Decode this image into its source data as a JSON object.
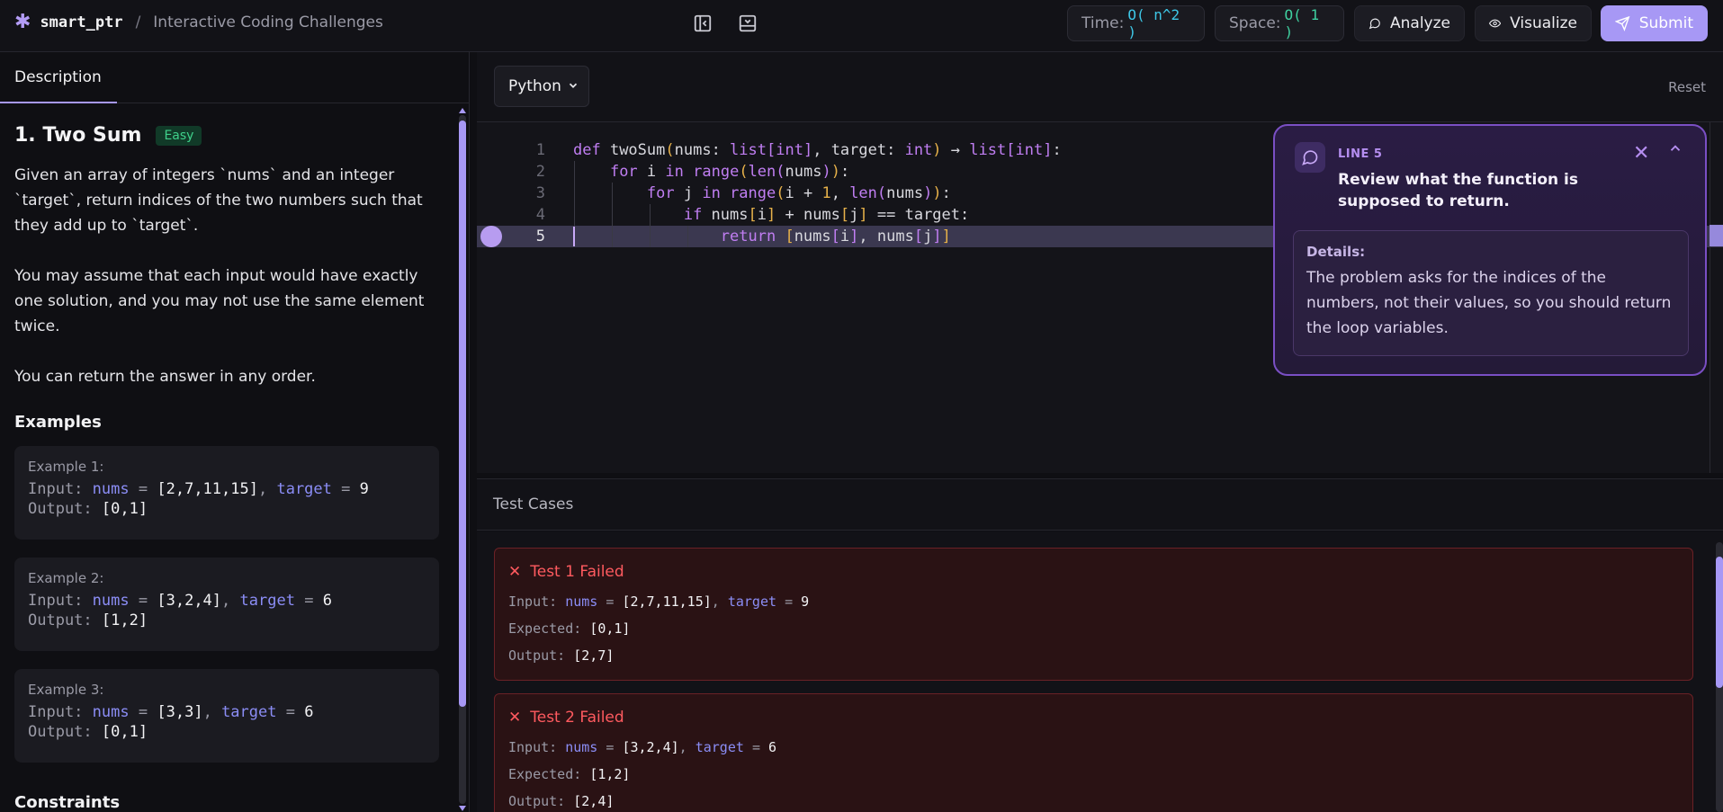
{
  "header": {
    "brand_name": "smart_ptr",
    "brand_sep": "/",
    "subtitle": "Interactive Coding Challenges",
    "time_label": "Time:",
    "time_value": "O( n^2 )",
    "space_label": "Space:",
    "space_value": "O( 1 )",
    "analyze": "Analyze",
    "visualize": "Visualize",
    "submit": "Submit"
  },
  "left": {
    "tab": "Description",
    "title": "1. Two Sum",
    "difficulty": "Easy",
    "p1": "Given an array of integers `nums` and an integer `target`, return indices of the two numbers such that they add up to `target`.",
    "p2": "You may assume that each input would have exactly one solution, and you may not use the same element twice.",
    "p3": "You can return the answer in any order.",
    "examples_heading": "Examples",
    "constraints_heading": "Constraints",
    "examples": [
      {
        "title": "Example 1:",
        "input_label": "Input:",
        "v1": "nums",
        "eq1": "=",
        "val1": "[2,7,11,15]",
        "comma": ",",
        "v2": "target",
        "eq2": "=",
        "val2": "9",
        "output_label": "Output:",
        "output": "[0,1]"
      },
      {
        "title": "Example 2:",
        "input_label": "Input:",
        "v1": "nums",
        "eq1": "=",
        "val1": "[3,2,4]",
        "comma": ",",
        "v2": "target",
        "eq2": "=",
        "val2": "6",
        "output_label": "Output:",
        "output": "[1,2]"
      },
      {
        "title": "Example 3:",
        "input_label": "Input:",
        "v1": "nums",
        "eq1": "=",
        "val1": "[3,3]",
        "comma": ",",
        "v2": "target",
        "eq2": "=",
        "val2": "6",
        "output_label": "Output:",
        "output": "[0,1]"
      }
    ]
  },
  "editor": {
    "language": "Python",
    "reset": "Reset",
    "line_numbers": [
      "1",
      "2",
      "3",
      "4",
      "5"
    ]
  },
  "review": {
    "line": "LINE 5",
    "title": "Review what the function is supposed to return.",
    "details_heading": "Details:",
    "details_body": "The problem asks for the indices of the numbers, not their values, so you should return the loop variables."
  },
  "tests": {
    "heading": "Test Cases",
    "cases": [
      {
        "status": "Test 1 Failed",
        "input_label": "Input:",
        "v1": "nums",
        "eq1": "=",
        "val1": "[2,7,11,15]",
        "comma": ",",
        "v2": "target",
        "eq2": "=",
        "val2": "9",
        "expected_label": "Expected:",
        "expected": "[0,1]",
        "output_label": "Output:",
        "output": "[2,7]"
      },
      {
        "status": "Test 2 Failed",
        "input_label": "Input:",
        "v1": "nums",
        "eq1": "=",
        "val1": "[3,2,4]",
        "comma": ",",
        "v2": "target",
        "eq2": "=",
        "val2": "6",
        "expected_label": "Expected:",
        "expected": "[1,2]",
        "output_label": "Output:",
        "output": "[2,4]"
      }
    ]
  }
}
